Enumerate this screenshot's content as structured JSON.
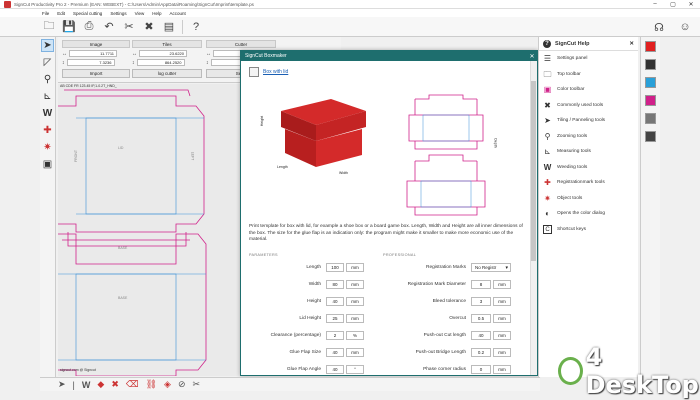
{
  "window": {
    "title": "SignCut Productivity Pro 2 - Premium (EAN: WEBEXT) - C:\\Users\\Admin\\AppData\\Roaming\\SignCut\\Imprint\\template.ps"
  },
  "menu": [
    "File",
    "Edit",
    "Special cutting",
    "Settings",
    "View",
    "Help",
    "Account"
  ],
  "props": {
    "image_label": "Image",
    "tiles_label": "Tiles",
    "cutter_label": "Cutter",
    "image_w": "11.7711",
    "image_h": "7.3236",
    "tiles_w": "23.6220",
    "tiles_h": "864.2520",
    "import_label": "Import",
    "log_cutter_label": "log cutter",
    "send_label": "Send"
  },
  "canvas": {
    "status": "AB CDE FR 123.45 IP,1-0.2T_HND_",
    "top_center": "LID",
    "top_left": "FRONT",
    "top_right": "LEFT",
    "bottom_top": "BASE",
    "bottom_center": "BASE",
    "bottom_label": "signcut.com @ Signcut"
  },
  "dialog": {
    "title": "SignCut Boxmaker",
    "link": "Box with lid",
    "model_labels": {
      "height": "Height",
      "length": "Length",
      "width": "Width",
      "depth": "Depth"
    },
    "description": "Print template for box with lid, for example a shoe box or a board game box. Length, Width and Height are all inner dimensions of the box. The size for the glue flap is an indication only: the program might make it smaller to make more economic use of the material.",
    "parameters_heading": "PARAMETERS",
    "professional_heading": "PROFESSIONAL",
    "params": [
      {
        "label": "Length",
        "value": "100",
        "unit": "mm"
      },
      {
        "label": "Width",
        "value": "80",
        "unit": "mm"
      },
      {
        "label": "Height",
        "value": "40",
        "unit": "mm"
      },
      {
        "label": "Lid Height",
        "value": "25",
        "unit": "mm"
      },
      {
        "label": "Clearance (percentage)",
        "value": "2",
        "unit": "%"
      },
      {
        "label": "Glue Flap Size",
        "value": "40",
        "unit": "mm"
      },
      {
        "label": "Glue Flap Angle",
        "value": "40",
        "unit": "°"
      }
    ],
    "professional": [
      {
        "label": "Registration Marks",
        "value": "No Registr",
        "select": true
      },
      {
        "label": "Registration Mark Diameter",
        "value": "8",
        "unit": "mm"
      },
      {
        "label": "Bleed tolerance",
        "value": "3",
        "unit": "mm"
      },
      {
        "label": "Overcut",
        "value": "0.5",
        "unit": "mm"
      },
      {
        "label": "Push-out Cut length",
        "value": "40",
        "unit": "mm"
      },
      {
        "label": "Push-out Bridge Length",
        "value": "0.2",
        "unit": "mm"
      },
      {
        "label": "Phase corner radius",
        "value": "0",
        "unit": "mm"
      }
    ]
  },
  "help": {
    "title": "SignCut Help",
    "items": [
      {
        "label": "Settings panel",
        "icon": "sliders-icon"
      },
      {
        "label": "Top toolbar",
        "icon": "folder-icon"
      },
      {
        "label": "Color toolbar",
        "icon": "palette-icon"
      },
      {
        "label": "Commonly used tools",
        "icon": "tools-icon"
      },
      {
        "label": "Tiling / Panneling tools",
        "icon": "cursor-icon"
      },
      {
        "label": "Zooming tools",
        "icon": "magnifier-icon"
      },
      {
        "label": "Measuring tools",
        "icon": "ruler-icon"
      },
      {
        "label": "Weeding tools",
        "icon": "w-icon"
      },
      {
        "label": "Registrationmark tools",
        "icon": "target-icon"
      },
      {
        "label": "Object tools",
        "icon": "object-icon"
      },
      {
        "label": "Opens the color dialog",
        "icon": "color-dialog-icon"
      },
      {
        "label": "Shortcut keys",
        "icon": "c-key-icon"
      }
    ]
  },
  "swatches": [
    "#e02020",
    "#333333",
    "#2aa0d8",
    "#d0218a",
    "#777777",
    "#444444"
  ],
  "watermark": "4 DeskTop"
}
